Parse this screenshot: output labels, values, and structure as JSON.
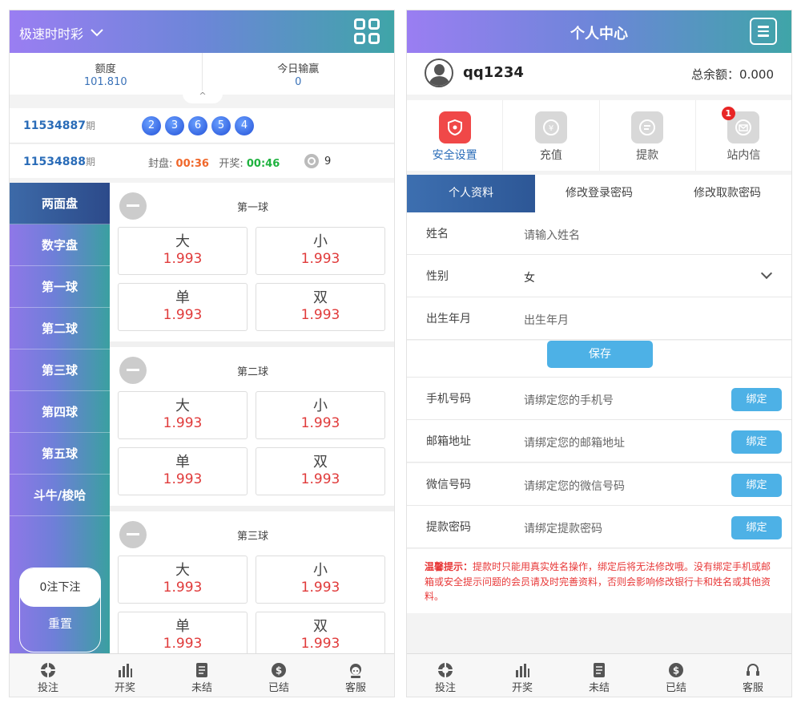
{
  "left": {
    "game_title": "极速时时彩",
    "stats": [
      {
        "label": "额度",
        "value": "101.810"
      },
      {
        "label": "今日输赢",
        "value": "0"
      }
    ],
    "pull_tab": "^",
    "last_draw": {
      "period": "11534887",
      "period_suffix": "期",
      "balls": [
        "2",
        "3",
        "6",
        "5",
        "4"
      ]
    },
    "next_draw": {
      "period": "11534888",
      "period_suffix": "期",
      "close_label": "封盘:",
      "close_time": "00:36",
      "open_label": "开奖:",
      "open_time": "00:46",
      "count": "9"
    },
    "nav": [
      "两面盘",
      "数字盘",
      "第一球",
      "第二球",
      "第三球",
      "第四球",
      "第五球",
      "斗牛/梭哈"
    ],
    "bet_count": "0注下注",
    "reset": "重置",
    "groups": [
      {
        "title": "第一球",
        "options": [
          {
            "name": "大",
            "odds": "1.993"
          },
          {
            "name": "小",
            "odds": "1.993"
          },
          {
            "name": "单",
            "odds": "1.993"
          },
          {
            "name": "双",
            "odds": "1.993"
          }
        ]
      },
      {
        "title": "第二球",
        "options": [
          {
            "name": "大",
            "odds": "1.993"
          },
          {
            "name": "小",
            "odds": "1.993"
          },
          {
            "name": "单",
            "odds": "1.993"
          },
          {
            "name": "双",
            "odds": "1.993"
          }
        ]
      },
      {
        "title": "第三球",
        "options": [
          {
            "name": "大",
            "odds": "1.993"
          },
          {
            "name": "小",
            "odds": "1.993"
          },
          {
            "name": "单",
            "odds": "1.993"
          },
          {
            "name": "双",
            "odds": "1.993"
          }
        ]
      }
    ]
  },
  "tabbar": [
    {
      "label": "投注",
      "icon": "chip-icon"
    },
    {
      "label": "开奖",
      "icon": "bar-chart-icon"
    },
    {
      "label": "未结",
      "icon": "document-icon"
    },
    {
      "label": "已结",
      "icon": "dollar-icon"
    },
    {
      "label": "客服",
      "icon": "support-icon"
    }
  ],
  "right": {
    "title": "个人中心",
    "username": "qq1234",
    "balance": "总余额：0.000",
    "quick": [
      {
        "label": "安全设置",
        "icon": "shield-icon"
      },
      {
        "label": "充值",
        "icon": "yen-icon"
      },
      {
        "label": "提款",
        "icon": "withdraw-icon"
      },
      {
        "label": "站内信",
        "icon": "mail-icon",
        "badge": "1"
      }
    ],
    "profile_tabs": [
      "个人资料",
      "修改登录密码",
      "修改取款密码"
    ],
    "form": {
      "name": {
        "label": "姓名",
        "placeholder": "请输入姓名"
      },
      "gender": {
        "label": "性别",
        "value": "女"
      },
      "birth": {
        "label": "出生年月",
        "placeholder": "出生年月"
      },
      "save": "保存"
    },
    "bindings": [
      {
        "label": "手机号码",
        "placeholder": "请绑定您的手机号",
        "button": "绑定"
      },
      {
        "label": "邮箱地址",
        "placeholder": "请绑定您的邮箱地址",
        "button": "绑定"
      },
      {
        "label": "微信号码",
        "placeholder": "请绑定您的微信号码",
        "button": "绑定"
      },
      {
        "label": "提款密码",
        "placeholder": "请绑定提款密码",
        "button": "绑定"
      }
    ],
    "tip_title": "温馨提示：",
    "tip_body": "提款时只能用真实姓名操作，绑定后将无法修改哦。没有绑定手机或邮箱或安全提示问题的会员请及时完善资料，否则会影响修改银行卡和姓名或其他资料。"
  },
  "colors": {
    "accent": "#2a6cb8",
    "odds": "#e03a3a",
    "bind": "#4db1e6",
    "header_start": "#9a7ef2",
    "header_end": "#3fa5a8"
  }
}
